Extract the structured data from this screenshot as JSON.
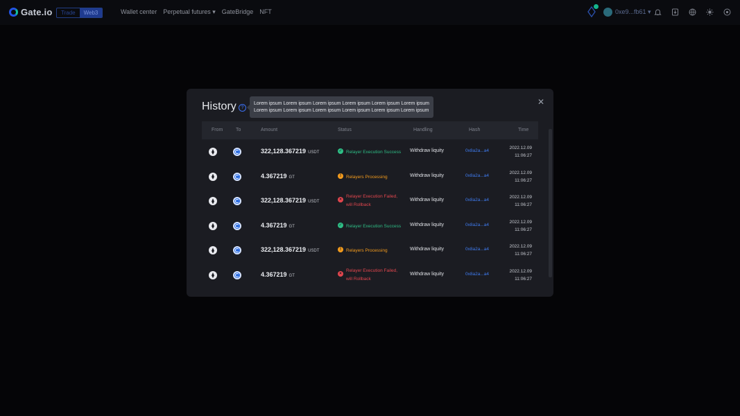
{
  "header": {
    "brand": "Gate.io",
    "segments": [
      "Trade",
      "Web3"
    ],
    "nav": [
      {
        "label": "Wallet center"
      },
      {
        "label": "Perpetual futures ▾"
      },
      {
        "label": "GateBridge"
      },
      {
        "label": "NFT"
      }
    ],
    "account": "0xe9...fb61 ▾"
  },
  "modal": {
    "title": "History",
    "close": "✕",
    "tooltip": "Lorem ipsum Lorem ipsum Lorem ipsum Lorem ipsum Lorem ipsum Lorem ipsum Lorem ipsum Lorem ipsum Lorem ipsum Lorem ipsum Lorem ipsum Lorem ipsum",
    "columns": {
      "from": "From",
      "to": "To",
      "amount": "Amount",
      "status": "Status",
      "handling": "Handling",
      "hash": "Hash",
      "time": "Time"
    },
    "rows": [
      {
        "amount": "322,128.367219",
        "unit": "USDT",
        "status": "success",
        "status_text": "Relayer Execution Success",
        "status_glyph": "✓",
        "handling": "Withdraw liquity",
        "hash": "0x8a2a...a4",
        "date": "2022.12.09",
        "clock": "11:06:27"
      },
      {
        "amount": "4.367219",
        "unit": "GT",
        "status": "processing",
        "status_text": "Relayers Processing",
        "status_glyph": "!",
        "handling": "Withdraw liquity",
        "hash": "0x8a2a...a4",
        "date": "2022.12.09",
        "clock": "11:06:27"
      },
      {
        "amount": "322,128.367219",
        "unit": "USDT",
        "status": "failed",
        "status_text": "Relayer Execution Failed,\nwill Rollback",
        "status_glyph": "×",
        "handling": "Withdraw liquity",
        "hash": "0x8a2a...a4",
        "date": "2022.12.09",
        "clock": "11:06:27"
      },
      {
        "amount": "4.367219",
        "unit": "GT",
        "status": "success",
        "status_text": "Relayer Execution Success",
        "status_glyph": "✓",
        "handling": "Withdraw liquity",
        "hash": "0x8a2a...a4",
        "date": "2022.12.09",
        "clock": "11:06:27"
      },
      {
        "amount": "322,128.367219",
        "unit": "USDT",
        "status": "processing",
        "status_text": "Relayers Processing",
        "status_glyph": "!",
        "handling": "Withdraw liquity",
        "hash": "0x8a2a...a4",
        "date": "2022.12.09",
        "clock": "11:06:27"
      },
      {
        "amount": "4.367219",
        "unit": "GT",
        "status": "failed",
        "status_text": "Relayer Execution Failed,\nwill Rollback",
        "status_glyph": "×",
        "handling": "Withdraw liquity",
        "hash": "0x8a2a...a4",
        "date": "2022.12.09",
        "clock": "11:06:27"
      }
    ]
  },
  "icons": {
    "from": "ethereum-icon",
    "to": "gatechain-icon",
    "toolbar": [
      "bell-icon",
      "download-icon",
      "globe-icon",
      "theme-icon",
      "settings-icon"
    ]
  },
  "colors": {
    "success": "#2ebd85",
    "processing": "#f39b1d",
    "failed": "#e2464e",
    "link": "#3f7cf2",
    "brand": "#2354e6"
  }
}
